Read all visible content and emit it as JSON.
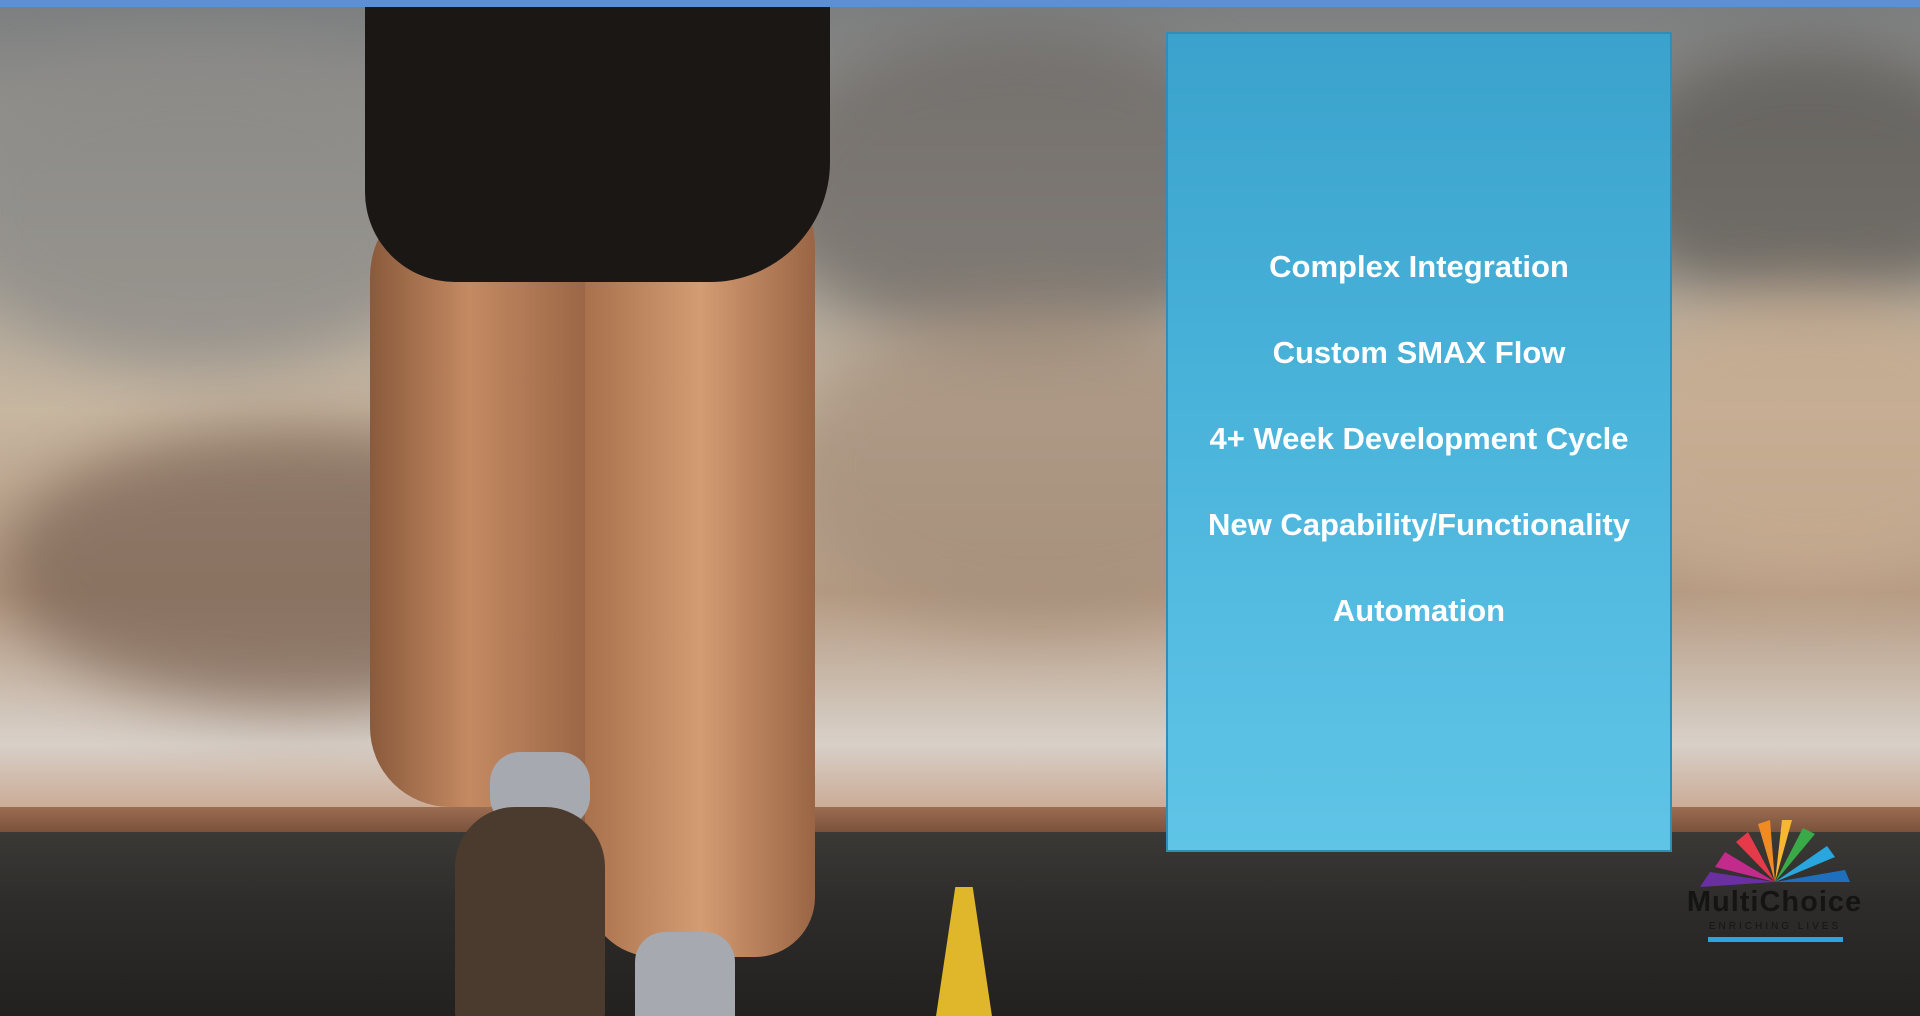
{
  "slide": {
    "panel_items": [
      "Complex Integration",
      "Custom SMAX Flow",
      "4+ Week Development Cycle",
      "New Capability/Functionality",
      "Automation"
    ],
    "logo": {
      "name": "MultiChoice",
      "tagline": "ENRICHING LIVES"
    }
  },
  "colors": {
    "top_bar": "#5b8fd6",
    "panel": "#4ab3da",
    "panel_text": "#ffffff"
  }
}
